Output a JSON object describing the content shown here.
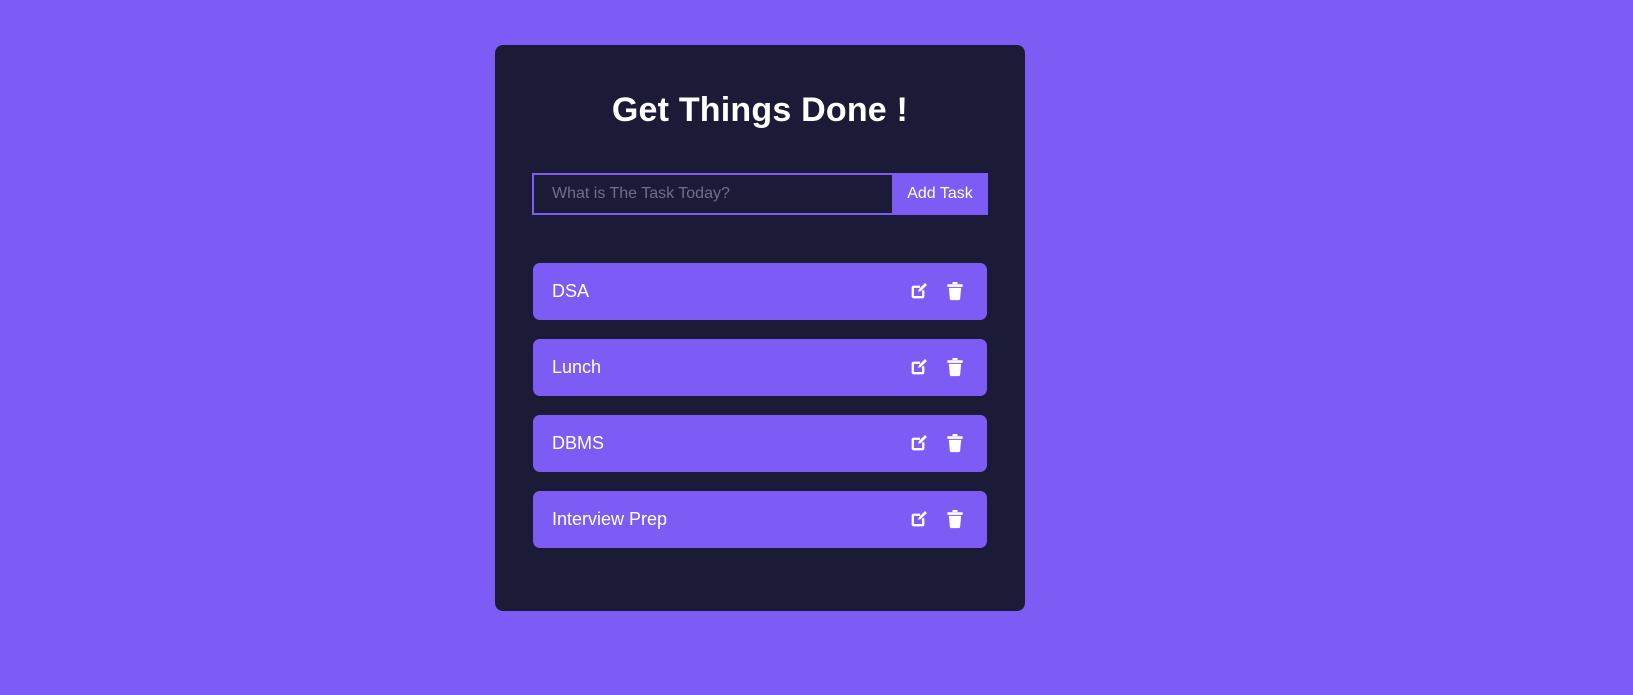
{
  "theme": {
    "page_background": "#7c5cf5",
    "panel_background": "#1b1b38",
    "accent": "#7c5cf5",
    "text_primary": "#ffffff",
    "placeholder_text": "#6f6f8c"
  },
  "panel": {
    "title": "Get Things Done !"
  },
  "form": {
    "input_value": "",
    "input_placeholder": "What is The Task Today?",
    "add_button_label": "Add Task"
  },
  "tasks": [
    {
      "label": "DSA",
      "edit_icon": "edit-pencil-square-icon",
      "delete_icon": "trash-icon"
    },
    {
      "label": "Lunch",
      "edit_icon": "edit-pencil-square-icon",
      "delete_icon": "trash-icon"
    },
    {
      "label": "DBMS",
      "edit_icon": "edit-pencil-square-icon",
      "delete_icon": "trash-icon"
    },
    {
      "label": "Interview Prep",
      "edit_icon": "edit-pencil-square-icon",
      "delete_icon": "trash-icon"
    }
  ]
}
